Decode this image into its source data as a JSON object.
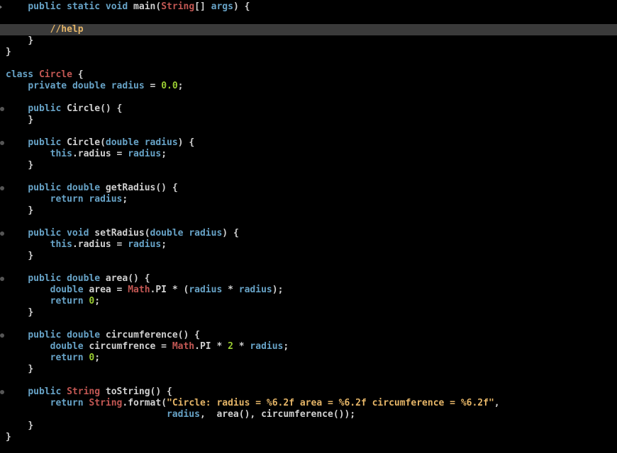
{
  "code": {
    "lines": [
      {
        "indent": 1,
        "marker": "arrow",
        "hl": false,
        "tokens": [
          {
            "t": "public ",
            "c": "kw"
          },
          {
            "t": "static ",
            "c": "kw"
          },
          {
            "t": "void ",
            "c": "kw"
          },
          {
            "t": "main",
            "c": "id"
          },
          {
            "t": "(",
            "c": "pn"
          },
          {
            "t": "String",
            "c": "type"
          },
          {
            "t": "[] ",
            "c": "pn"
          },
          {
            "t": "args",
            "c": "var"
          },
          {
            "t": ") {",
            "c": "pn"
          }
        ]
      },
      {
        "indent": 0,
        "marker": "none",
        "hl": false,
        "tokens": []
      },
      {
        "indent": 2,
        "marker": "none",
        "hl": true,
        "tokens": [
          {
            "t": "//help",
            "c": "cmt"
          }
        ]
      },
      {
        "indent": 1,
        "marker": "none",
        "hl": false,
        "tokens": [
          {
            "t": "}",
            "c": "pn"
          }
        ]
      },
      {
        "indent": 0,
        "marker": "none",
        "hl": false,
        "tokens": [
          {
            "t": "}",
            "c": "pn"
          }
        ]
      },
      {
        "indent": 0,
        "marker": "none",
        "hl": false,
        "tokens": []
      },
      {
        "indent": 0,
        "marker": "none",
        "hl": false,
        "tokens": [
          {
            "t": "class ",
            "c": "kw"
          },
          {
            "t": "Circle",
            "c": "type"
          },
          {
            "t": " {",
            "c": "pn"
          }
        ]
      },
      {
        "indent": 1,
        "marker": "none",
        "hl": false,
        "tokens": [
          {
            "t": "private ",
            "c": "kw"
          },
          {
            "t": "double ",
            "c": "kw"
          },
          {
            "t": "radius",
            "c": "var"
          },
          {
            "t": " = ",
            "c": "pn"
          },
          {
            "t": "0.0",
            "c": "num"
          },
          {
            "t": ";",
            "c": "pn"
          }
        ]
      },
      {
        "indent": 0,
        "marker": "none",
        "hl": false,
        "tokens": []
      },
      {
        "indent": 1,
        "marker": "dot",
        "hl": false,
        "tokens": [
          {
            "t": "public ",
            "c": "kw"
          },
          {
            "t": "Circle",
            "c": "id"
          },
          {
            "t": "() {",
            "c": "pn"
          }
        ]
      },
      {
        "indent": 1,
        "marker": "none",
        "hl": false,
        "tokens": [
          {
            "t": "}",
            "c": "pn"
          }
        ]
      },
      {
        "indent": 0,
        "marker": "none",
        "hl": false,
        "tokens": []
      },
      {
        "indent": 1,
        "marker": "dot",
        "hl": false,
        "tokens": [
          {
            "t": "public ",
            "c": "kw"
          },
          {
            "t": "Circle",
            "c": "id"
          },
          {
            "t": "(",
            "c": "pn"
          },
          {
            "t": "double ",
            "c": "kw"
          },
          {
            "t": "radius",
            "c": "var"
          },
          {
            "t": ") {",
            "c": "pn"
          }
        ]
      },
      {
        "indent": 2,
        "marker": "none",
        "hl": false,
        "tokens": [
          {
            "t": "this",
            "c": "kw"
          },
          {
            "t": ".",
            "c": "pn"
          },
          {
            "t": "radius",
            "c": "id"
          },
          {
            "t": " = ",
            "c": "pn"
          },
          {
            "t": "radius",
            "c": "var"
          },
          {
            "t": ";",
            "c": "pn"
          }
        ]
      },
      {
        "indent": 1,
        "marker": "none",
        "hl": false,
        "tokens": [
          {
            "t": "}",
            "c": "pn"
          }
        ]
      },
      {
        "indent": 0,
        "marker": "none",
        "hl": false,
        "tokens": []
      },
      {
        "indent": 1,
        "marker": "dot",
        "hl": false,
        "tokens": [
          {
            "t": "public ",
            "c": "kw"
          },
          {
            "t": "double ",
            "c": "kw"
          },
          {
            "t": "getRadius",
            "c": "id"
          },
          {
            "t": "() {",
            "c": "pn"
          }
        ]
      },
      {
        "indent": 2,
        "marker": "none",
        "hl": false,
        "tokens": [
          {
            "t": "return ",
            "c": "kw"
          },
          {
            "t": "radius",
            "c": "var"
          },
          {
            "t": ";",
            "c": "pn"
          }
        ]
      },
      {
        "indent": 1,
        "marker": "none",
        "hl": false,
        "tokens": [
          {
            "t": "}",
            "c": "pn"
          }
        ]
      },
      {
        "indent": 0,
        "marker": "none",
        "hl": false,
        "tokens": []
      },
      {
        "indent": 1,
        "marker": "dot",
        "hl": false,
        "tokens": [
          {
            "t": "public ",
            "c": "kw"
          },
          {
            "t": "void ",
            "c": "kw"
          },
          {
            "t": "setRadius",
            "c": "id"
          },
          {
            "t": "(",
            "c": "pn"
          },
          {
            "t": "double ",
            "c": "kw"
          },
          {
            "t": "radius",
            "c": "var"
          },
          {
            "t": ") {",
            "c": "pn"
          }
        ]
      },
      {
        "indent": 2,
        "marker": "none",
        "hl": false,
        "tokens": [
          {
            "t": "this",
            "c": "kw"
          },
          {
            "t": ".",
            "c": "pn"
          },
          {
            "t": "radius",
            "c": "id"
          },
          {
            "t": " = ",
            "c": "pn"
          },
          {
            "t": "radius",
            "c": "var"
          },
          {
            "t": ";",
            "c": "pn"
          }
        ]
      },
      {
        "indent": 1,
        "marker": "none",
        "hl": false,
        "tokens": [
          {
            "t": "}",
            "c": "pn"
          }
        ]
      },
      {
        "indent": 0,
        "marker": "none",
        "hl": false,
        "tokens": []
      },
      {
        "indent": 1,
        "marker": "dot",
        "hl": false,
        "tokens": [
          {
            "t": "public ",
            "c": "kw"
          },
          {
            "t": "double ",
            "c": "kw"
          },
          {
            "t": "area",
            "c": "id"
          },
          {
            "t": "() {",
            "c": "pn"
          }
        ]
      },
      {
        "indent": 2,
        "marker": "none",
        "hl": false,
        "tokens": [
          {
            "t": "double ",
            "c": "kw"
          },
          {
            "t": "area",
            "c": "id"
          },
          {
            "t": " = ",
            "c": "pn"
          },
          {
            "t": "Math",
            "c": "type"
          },
          {
            "t": ".",
            "c": "pn"
          },
          {
            "t": "PI",
            "c": "id"
          },
          {
            "t": " * (",
            "c": "pn"
          },
          {
            "t": "radius",
            "c": "var"
          },
          {
            "t": " * ",
            "c": "pn"
          },
          {
            "t": "radius",
            "c": "var"
          },
          {
            "t": ");",
            "c": "pn"
          }
        ]
      },
      {
        "indent": 2,
        "marker": "none",
        "hl": false,
        "tokens": [
          {
            "t": "return ",
            "c": "kw"
          },
          {
            "t": "0",
            "c": "num"
          },
          {
            "t": ";",
            "c": "pn"
          }
        ]
      },
      {
        "indent": 1,
        "marker": "none",
        "hl": false,
        "tokens": [
          {
            "t": "}",
            "c": "pn"
          }
        ]
      },
      {
        "indent": 0,
        "marker": "none",
        "hl": false,
        "tokens": []
      },
      {
        "indent": 1,
        "marker": "dot",
        "hl": false,
        "tokens": [
          {
            "t": "public ",
            "c": "kw"
          },
          {
            "t": "double ",
            "c": "kw"
          },
          {
            "t": "circumference",
            "c": "id"
          },
          {
            "t": "() {",
            "c": "pn"
          }
        ]
      },
      {
        "indent": 2,
        "marker": "none",
        "hl": false,
        "tokens": [
          {
            "t": "double ",
            "c": "kw"
          },
          {
            "t": "circumfrence",
            "c": "id"
          },
          {
            "t": " = ",
            "c": "pn"
          },
          {
            "t": "Math",
            "c": "type"
          },
          {
            "t": ".",
            "c": "pn"
          },
          {
            "t": "PI",
            "c": "id"
          },
          {
            "t": " * ",
            "c": "pn"
          },
          {
            "t": "2",
            "c": "num"
          },
          {
            "t": " * ",
            "c": "pn"
          },
          {
            "t": "radius",
            "c": "var"
          },
          {
            "t": ";",
            "c": "pn"
          }
        ]
      },
      {
        "indent": 2,
        "marker": "none",
        "hl": false,
        "tokens": [
          {
            "t": "return ",
            "c": "kw"
          },
          {
            "t": "0",
            "c": "num"
          },
          {
            "t": ";",
            "c": "pn"
          }
        ]
      },
      {
        "indent": 1,
        "marker": "none",
        "hl": false,
        "tokens": [
          {
            "t": "}",
            "c": "pn"
          }
        ]
      },
      {
        "indent": 0,
        "marker": "none",
        "hl": false,
        "tokens": []
      },
      {
        "indent": 1,
        "marker": "dot",
        "hl": false,
        "tokens": [
          {
            "t": "public ",
            "c": "kw"
          },
          {
            "t": "String",
            "c": "type"
          },
          {
            "t": " ",
            "c": "pn"
          },
          {
            "t": "toString",
            "c": "id"
          },
          {
            "t": "() {",
            "c": "pn"
          }
        ]
      },
      {
        "indent": 2,
        "marker": "none",
        "hl": false,
        "tokens": [
          {
            "t": "return ",
            "c": "kw"
          },
          {
            "t": "String",
            "c": "type"
          },
          {
            "t": ".",
            "c": "pn"
          },
          {
            "t": "format",
            "c": "id"
          },
          {
            "t": "(",
            "c": "pn"
          },
          {
            "t": "\"Circle: radius = %6.2f area = %6.2f circumference = %6.2f\"",
            "c": "str"
          },
          {
            "t": ",",
            "c": "pn"
          }
        ]
      },
      {
        "indent": 0,
        "marker": "none",
        "hl": false,
        "raw_indent": "                             ",
        "tokens": [
          {
            "t": "radius",
            "c": "var"
          },
          {
            "t": ",  ",
            "c": "pn"
          },
          {
            "t": "area",
            "c": "id"
          },
          {
            "t": "(), ",
            "c": "pn"
          },
          {
            "t": "circumference",
            "c": "id"
          },
          {
            "t": "());",
            "c": "pn"
          }
        ]
      },
      {
        "indent": 1,
        "marker": "none",
        "hl": false,
        "tokens": [
          {
            "t": "}",
            "c": "pn"
          }
        ]
      },
      {
        "indent": 0,
        "marker": "none",
        "hl": false,
        "tokens": [
          {
            "t": "}",
            "c": "pn"
          }
        ]
      }
    ],
    "indent_unit": "    "
  }
}
